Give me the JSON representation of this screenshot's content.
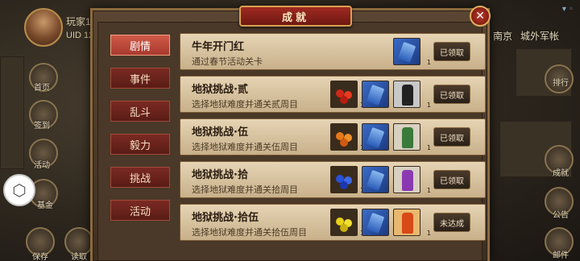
{
  "player": {
    "name": "玩家123",
    "uid": "UID 12398"
  },
  "left_menu": [
    {
      "label": "首页"
    },
    {
      "label": "签到"
    },
    {
      "label": "活动"
    },
    {
      "label": "基金"
    },
    {
      "label": "保存"
    },
    {
      "label": "读取"
    }
  ],
  "right_text": {
    "city": "南京",
    "camp": "城外军帐"
  },
  "right_menu": [
    {
      "label": "排行"
    },
    {
      "label": "成就"
    },
    {
      "label": "公告"
    },
    {
      "label": "邮件"
    }
  ],
  "dialog": {
    "title": "成就",
    "close_symbol": "✕",
    "tabs": [
      {
        "label": "剧情",
        "active": true
      },
      {
        "label": "事件",
        "active": false
      },
      {
        "label": "乱斗",
        "active": false
      },
      {
        "label": "毅力",
        "active": false
      },
      {
        "label": "挑战",
        "active": false
      },
      {
        "label": "活动",
        "active": false
      }
    ],
    "achievements": [
      {
        "title": "牛年开门红",
        "desc": "通过春节活动关卡",
        "rewards": [
          {
            "icon": "ticket-icon",
            "count": "1"
          }
        ],
        "button": "已领取"
      },
      {
        "title": "地狱挑战·贰",
        "desc": "选择地狱难度并通关贰周目",
        "rewards": [
          {
            "icon": "red-fruit-icon",
            "count": "10"
          },
          {
            "icon": "ticket-icon",
            "count": "1"
          },
          {
            "icon": "dark-warrior-icon",
            "count": "1"
          }
        ],
        "button": "已领取"
      },
      {
        "title": "地狱挑战·伍",
        "desc": "选择地狱难度并通关伍周目",
        "rewards": [
          {
            "icon": "orange-fruit-icon",
            "count": "10"
          },
          {
            "icon": "ticket-icon",
            "count": "1"
          },
          {
            "icon": "green-warrior-icon",
            "count": "1"
          }
        ],
        "button": "已领取"
      },
      {
        "title": "地狱挑战·拾",
        "desc": "选择地狱难度并通关拾周目",
        "rewards": [
          {
            "icon": "blue-fruit-icon",
            "count": "10"
          },
          {
            "icon": "ticket-icon",
            "count": "1"
          },
          {
            "icon": "purple-warrior-icon",
            "count": "1"
          }
        ],
        "button": "已领取"
      },
      {
        "title": "地狱挑战·拾伍",
        "desc": "选择地狱难度并通关拾伍周目",
        "rewards": [
          {
            "icon": "yellow-fruit-icon",
            "count": "10"
          },
          {
            "icon": "ticket-icon",
            "count": "1"
          },
          {
            "icon": "red-warrior-icon",
            "count": "1"
          }
        ],
        "button": "未达成"
      }
    ]
  }
}
